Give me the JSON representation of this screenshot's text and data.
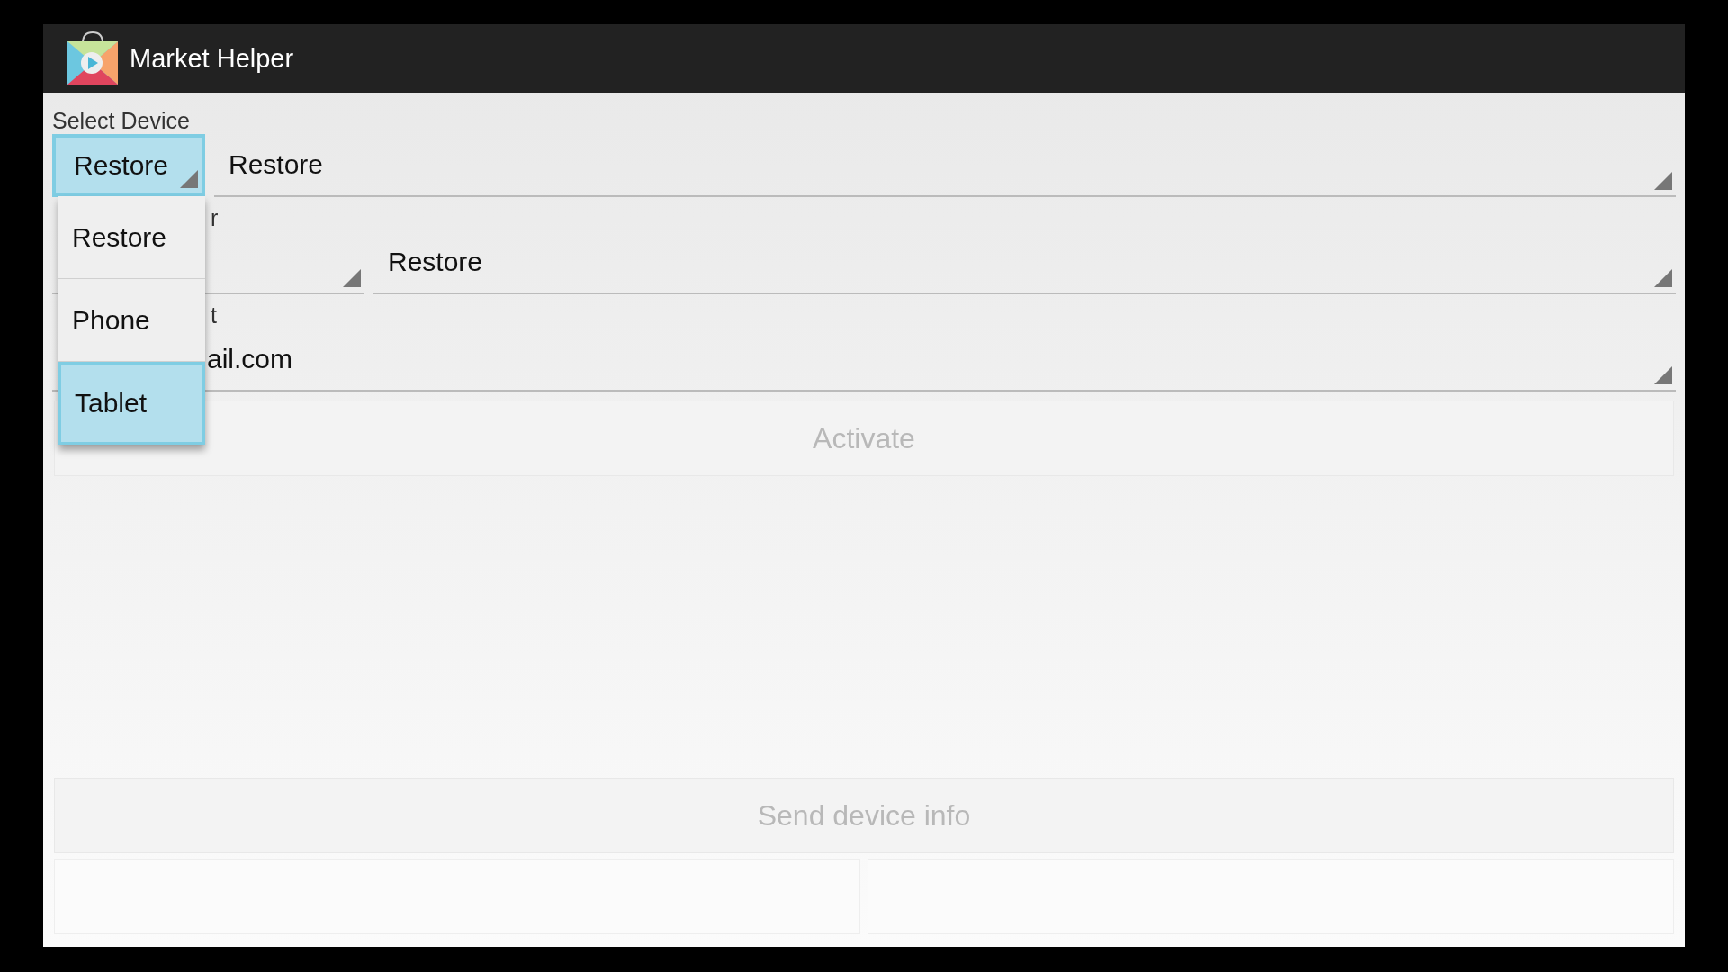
{
  "window": {
    "title": "Market Helper"
  },
  "rows": [
    {
      "label": "Select Device",
      "spinners": [
        {
          "value": "Restore",
          "focused": true,
          "wide": false
        },
        {
          "value": "Restore",
          "focused": false,
          "wide": true
        }
      ]
    },
    {
      "label_fragments": [
        "r"
      ],
      "spinners": [
        {
          "focused": false,
          "wide": false
        },
        {
          "value": "Restore",
          "focused": false,
          "wide": true
        }
      ]
    },
    {
      "label_fragments": [
        "t"
      ],
      "spinners": [
        {
          "value": "ail.com",
          "focused": false,
          "wide": true
        }
      ]
    }
  ],
  "dropdown": {
    "options": [
      {
        "label": "Restore",
        "selected": false
      },
      {
        "label": "Phone",
        "selected": false
      },
      {
        "label": "Tablet",
        "selected": true
      }
    ]
  },
  "buttons": [
    {
      "label": "Activate",
      "disabled": true
    },
    {
      "label": "Send device info",
      "disabled": true
    }
  ]
}
